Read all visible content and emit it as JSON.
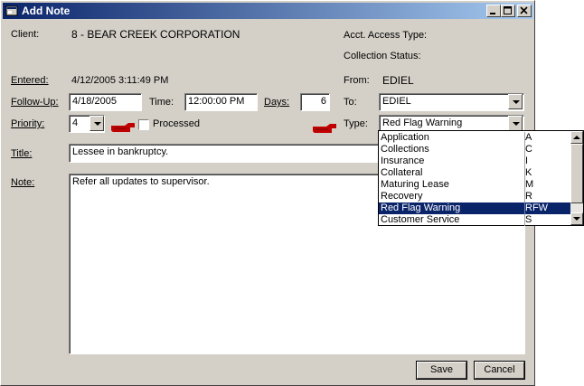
{
  "window": {
    "title": "Add Note"
  },
  "client": {
    "label": "Client:",
    "value": "8  -  BEAR CREEK CORPORATION"
  },
  "acct_access_type": {
    "label": "Acct. Access Type:"
  },
  "collection_status": {
    "label": "Collection Status:"
  },
  "entered": {
    "label": "Entered:",
    "value": "4/12/2005 3:11:49 PM"
  },
  "from": {
    "label": "From:",
    "value": "EDIEL"
  },
  "follow_up": {
    "label": "Follow-Up:",
    "value": "4/18/2005"
  },
  "time": {
    "label": "Time:",
    "value": "12:00:00 PM"
  },
  "days": {
    "label": "Days:",
    "value": "6"
  },
  "to": {
    "label": "To:",
    "value": "EDIEL"
  },
  "priority": {
    "label": "Priority:",
    "value": "4"
  },
  "processed": {
    "label": "Processed",
    "checked": false
  },
  "type": {
    "label": "Type:",
    "value": "Red Flag Warning",
    "options": [
      {
        "name": "Application",
        "code": "A"
      },
      {
        "name": "Collections",
        "code": "C"
      },
      {
        "name": "Insurance",
        "code": "I"
      },
      {
        "name": "Collateral",
        "code": "K"
      },
      {
        "name": "Maturing Lease",
        "code": "M"
      },
      {
        "name": "Recovery",
        "code": "R"
      },
      {
        "name": "Red Flag Warning",
        "code": "RFW"
      },
      {
        "name": "Customer Service",
        "code": "S"
      }
    ],
    "selected_index": 6
  },
  "title": {
    "label": "Title:",
    "value": "Lessee in bankruptcy."
  },
  "note": {
    "label": "Note:",
    "value": "Refer all updates to supervisor."
  },
  "buttons": {
    "save": "Save",
    "cancel": "Cancel"
  },
  "colors": {
    "titlebar": "#0a246a",
    "selection": "#0a246a",
    "pointer_hand": "#c00000"
  },
  "icons": {
    "window": "window-app-icon",
    "pointer": "pointing-hand-icon"
  }
}
